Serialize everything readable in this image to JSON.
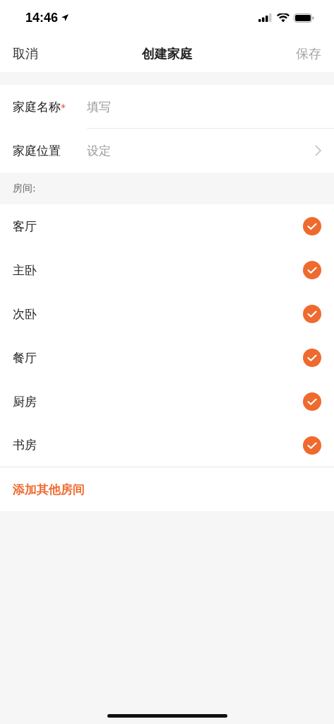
{
  "status_bar": {
    "time": "14:46"
  },
  "nav": {
    "cancel": "取消",
    "title": "创建家庭",
    "save": "保存",
    "save_disabled": true
  },
  "form": [
    {
      "kind": "input",
      "label": "家庭名称",
      "required_mark": "*",
      "placeholder": "填写"
    },
    {
      "kind": "link",
      "label": "家庭位置",
      "value": "设定"
    }
  ],
  "rooms_header": "房间:",
  "rooms": [
    {
      "name": "客厅",
      "checked": true
    },
    {
      "name": "主卧",
      "checked": true
    },
    {
      "name": "次卧",
      "checked": true
    },
    {
      "name": "餐厅",
      "checked": true
    },
    {
      "name": "厨房",
      "checked": true
    },
    {
      "name": "书房",
      "checked": true
    }
  ],
  "add_room": "添加其他房间"
}
